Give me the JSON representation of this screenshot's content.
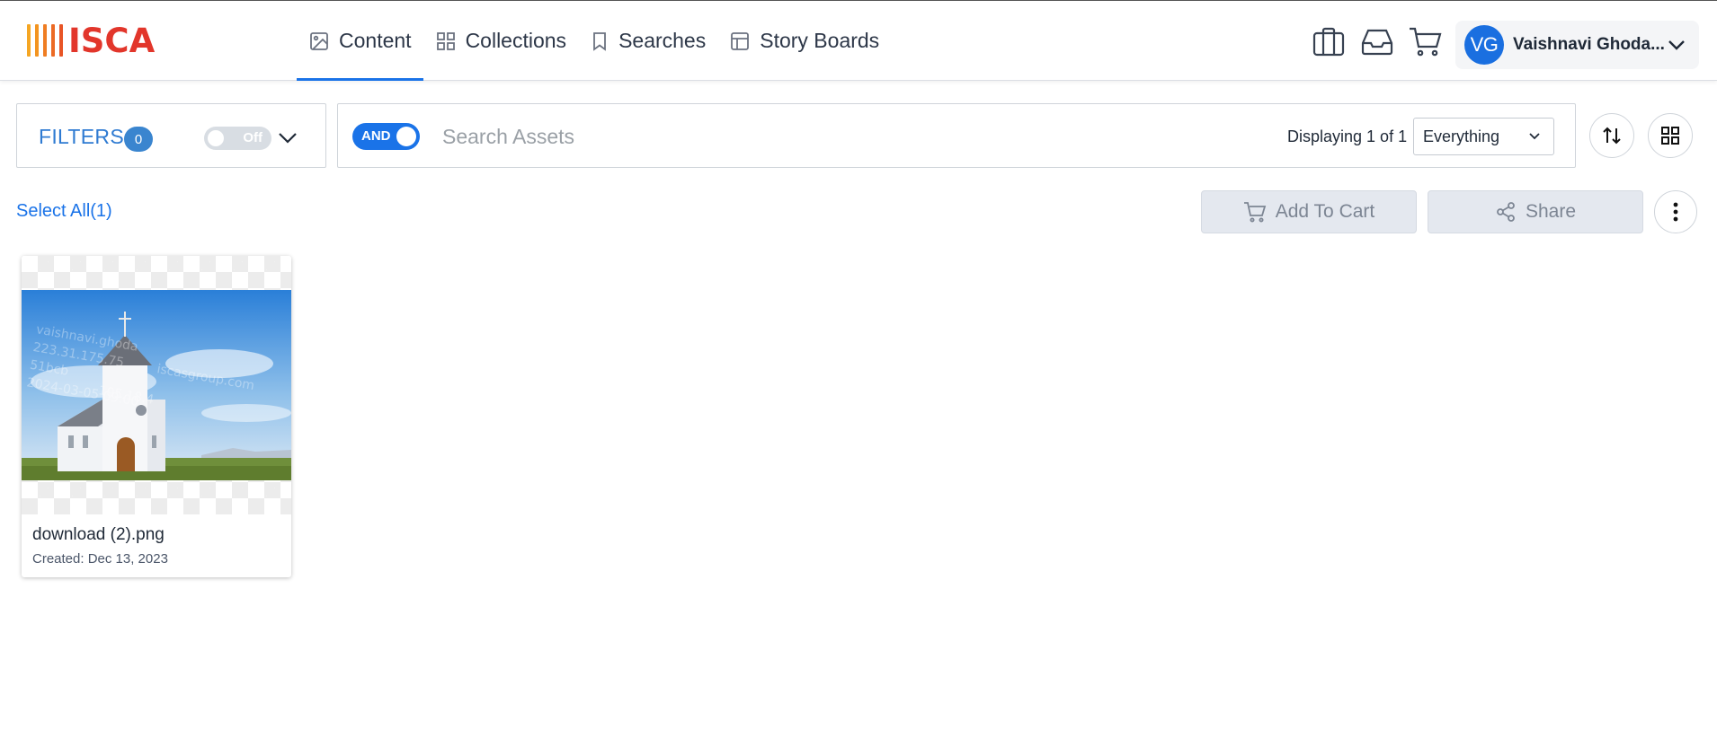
{
  "app": {
    "logo_text": "ISCA",
    "logo_bar_colors": [
      "#f5a623",
      "#f39420",
      "#ef7d22",
      "#ec6a24",
      "#e85526",
      "#e2362b"
    ],
    "accent_color": "#1a73e8"
  },
  "nav": {
    "tabs": [
      {
        "label": "Content",
        "icon": "image-icon",
        "active": true
      },
      {
        "label": "Collections",
        "icon": "grid-icon",
        "active": false
      },
      {
        "label": "Searches",
        "icon": "bookmark-icon",
        "active": false
      },
      {
        "label": "Story Boards",
        "icon": "layout-icon",
        "active": false
      }
    ]
  },
  "header_icons": [
    "briefcase-icon",
    "inbox-icon",
    "cart-icon"
  ],
  "user": {
    "initials": "VG",
    "name": "Vaishnavi Ghoda..."
  },
  "filters": {
    "label": "FILTERS",
    "count": "0",
    "toggle_label": "Off"
  },
  "search": {
    "operator_label": "AND",
    "placeholder": "Search Assets",
    "displaying": "Displaying 1 of 1",
    "scope_selected": "Everything"
  },
  "actions": {
    "select_all": "Select All(1)",
    "add_to_cart": "Add To Cart",
    "share": "Share"
  },
  "assets": [
    {
      "title": "download (2).png",
      "created": "Created: Dec 13, 2023"
    }
  ]
}
